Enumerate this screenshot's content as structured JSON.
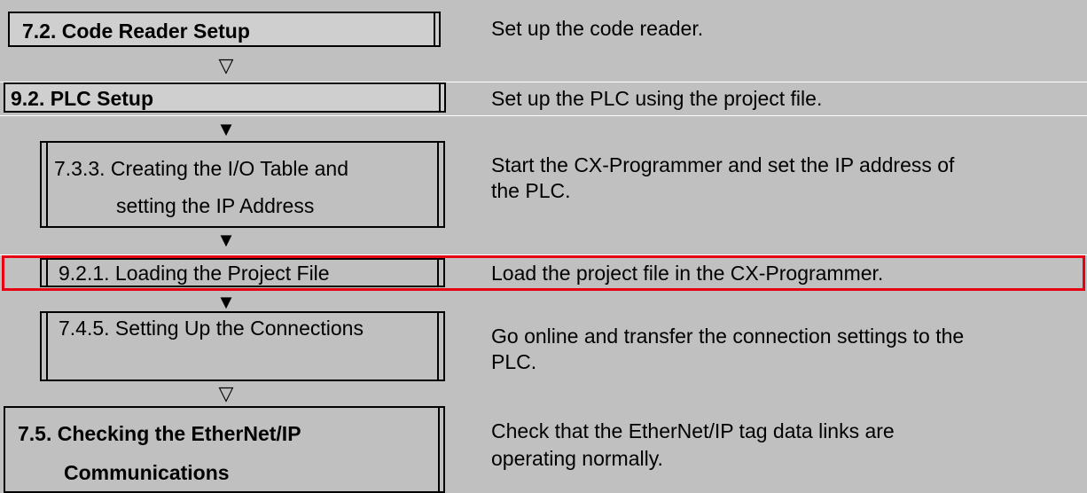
{
  "steps": [
    {
      "label": "7.2. Code Reader Setup",
      "description": "Set up the code reader."
    },
    {
      "label": "9.2. PLC Setup",
      "description": "Set up the PLC using the project file."
    },
    {
      "label_line1": "7.3.3. Creating the I/O Table and",
      "label_line2": "setting the IP Address",
      "description_line1": "Start the CX-Programmer and set the IP address of",
      "description_line2": "the PLC."
    },
    {
      "label": "9.2.1. Loading the Project File",
      "description": "Load the project file in the CX-Programmer."
    },
    {
      "label": "7.4.5. Setting Up the Connections",
      "description_line1": "Go online and transfer the connection settings to the",
      "description_line2": "PLC."
    },
    {
      "label_line1": "7.5. Checking the EtherNet/IP",
      "label_line2": "Communications",
      "description_line1": "Check that the EtherNet/IP tag data links are",
      "description_line2": "operating normally."
    }
  ],
  "arrows": {
    "hollow": "▽",
    "solid": "▼"
  },
  "colors": {
    "background": "#c0c0c0",
    "highlight": "#e60012"
  }
}
